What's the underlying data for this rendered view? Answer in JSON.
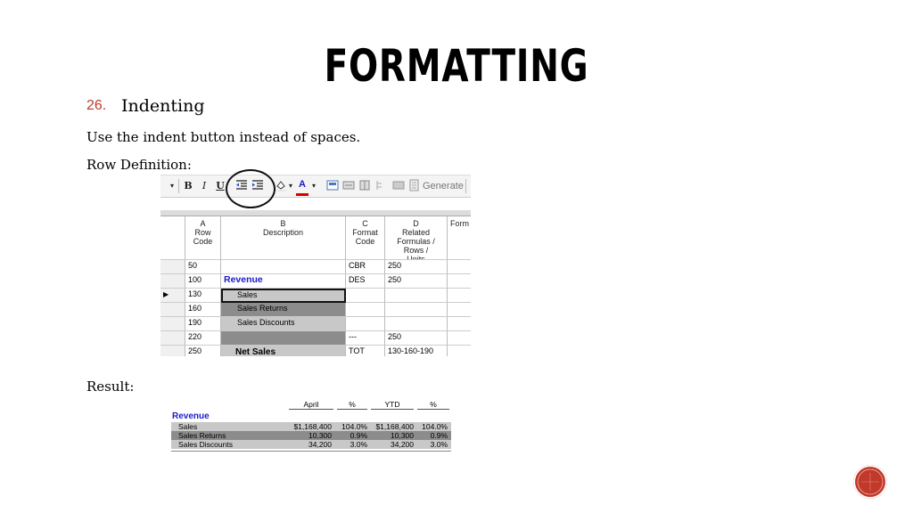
{
  "slide": {
    "title": "Formatting",
    "item_number": "26.",
    "item_label": "Indenting",
    "instruction": "Use the indent button instead of spaces.",
    "row_definition_label": "Row Definition:",
    "result_label": "Result:"
  },
  "toolbar": {
    "bold": "B",
    "italic": "I",
    "underline": "U",
    "font_color": "A",
    "generate": "Generate"
  },
  "grid": {
    "headers": [
      {
        "letter": "A",
        "title": "Row Code"
      },
      {
        "letter": "B",
        "title": "Description"
      },
      {
        "letter": "C",
        "title": "Format Code"
      },
      {
        "letter": "D",
        "title": "Related Formulas / Rows / Units"
      },
      {
        "letter": "",
        "title": "Form"
      }
    ],
    "rows": [
      {
        "code": "50",
        "desc": "",
        "format": "CBR",
        "formula": "250"
      },
      {
        "code": "100",
        "desc": "Revenue",
        "format": "DES",
        "formula": "250"
      },
      {
        "code": "130",
        "desc": "Sales",
        "format": "",
        "formula": ""
      },
      {
        "code": "160",
        "desc": "Sales Returns",
        "format": "",
        "formula": ""
      },
      {
        "code": "190",
        "desc": "Sales Discounts",
        "format": "",
        "formula": ""
      },
      {
        "code": "220",
        "desc": "",
        "format": "---",
        "formula": "250"
      },
      {
        "code": "250",
        "desc": "Net Sales",
        "format": "TOT",
        "formula": "130-160-190"
      }
    ]
  },
  "result": {
    "columns": [
      "April",
      "%",
      "YTD",
      "%"
    ],
    "heading": "Revenue",
    "rows": [
      {
        "label": "Sales",
        "april": "$1,168,400",
        "pct": "104.0%",
        "ytd": "$1,168,400",
        "ytd_pct": "104.0%"
      },
      {
        "label": "Sales Returns",
        "april": "10,300",
        "pct": "0.9%",
        "ytd": "10,300",
        "ytd_pct": "0.9%"
      },
      {
        "label": "Sales Discounts",
        "april": "34,200",
        "pct": "3.0%",
        "ytd": "34,200",
        "ytd_pct": "3.0%"
      }
    ]
  },
  "colors": {
    "accent": "#c0392b",
    "revenue_blue": "#1a1acc",
    "row_gray_light": "#c8c8c8",
    "row_gray_dark": "#8c8c8c"
  }
}
